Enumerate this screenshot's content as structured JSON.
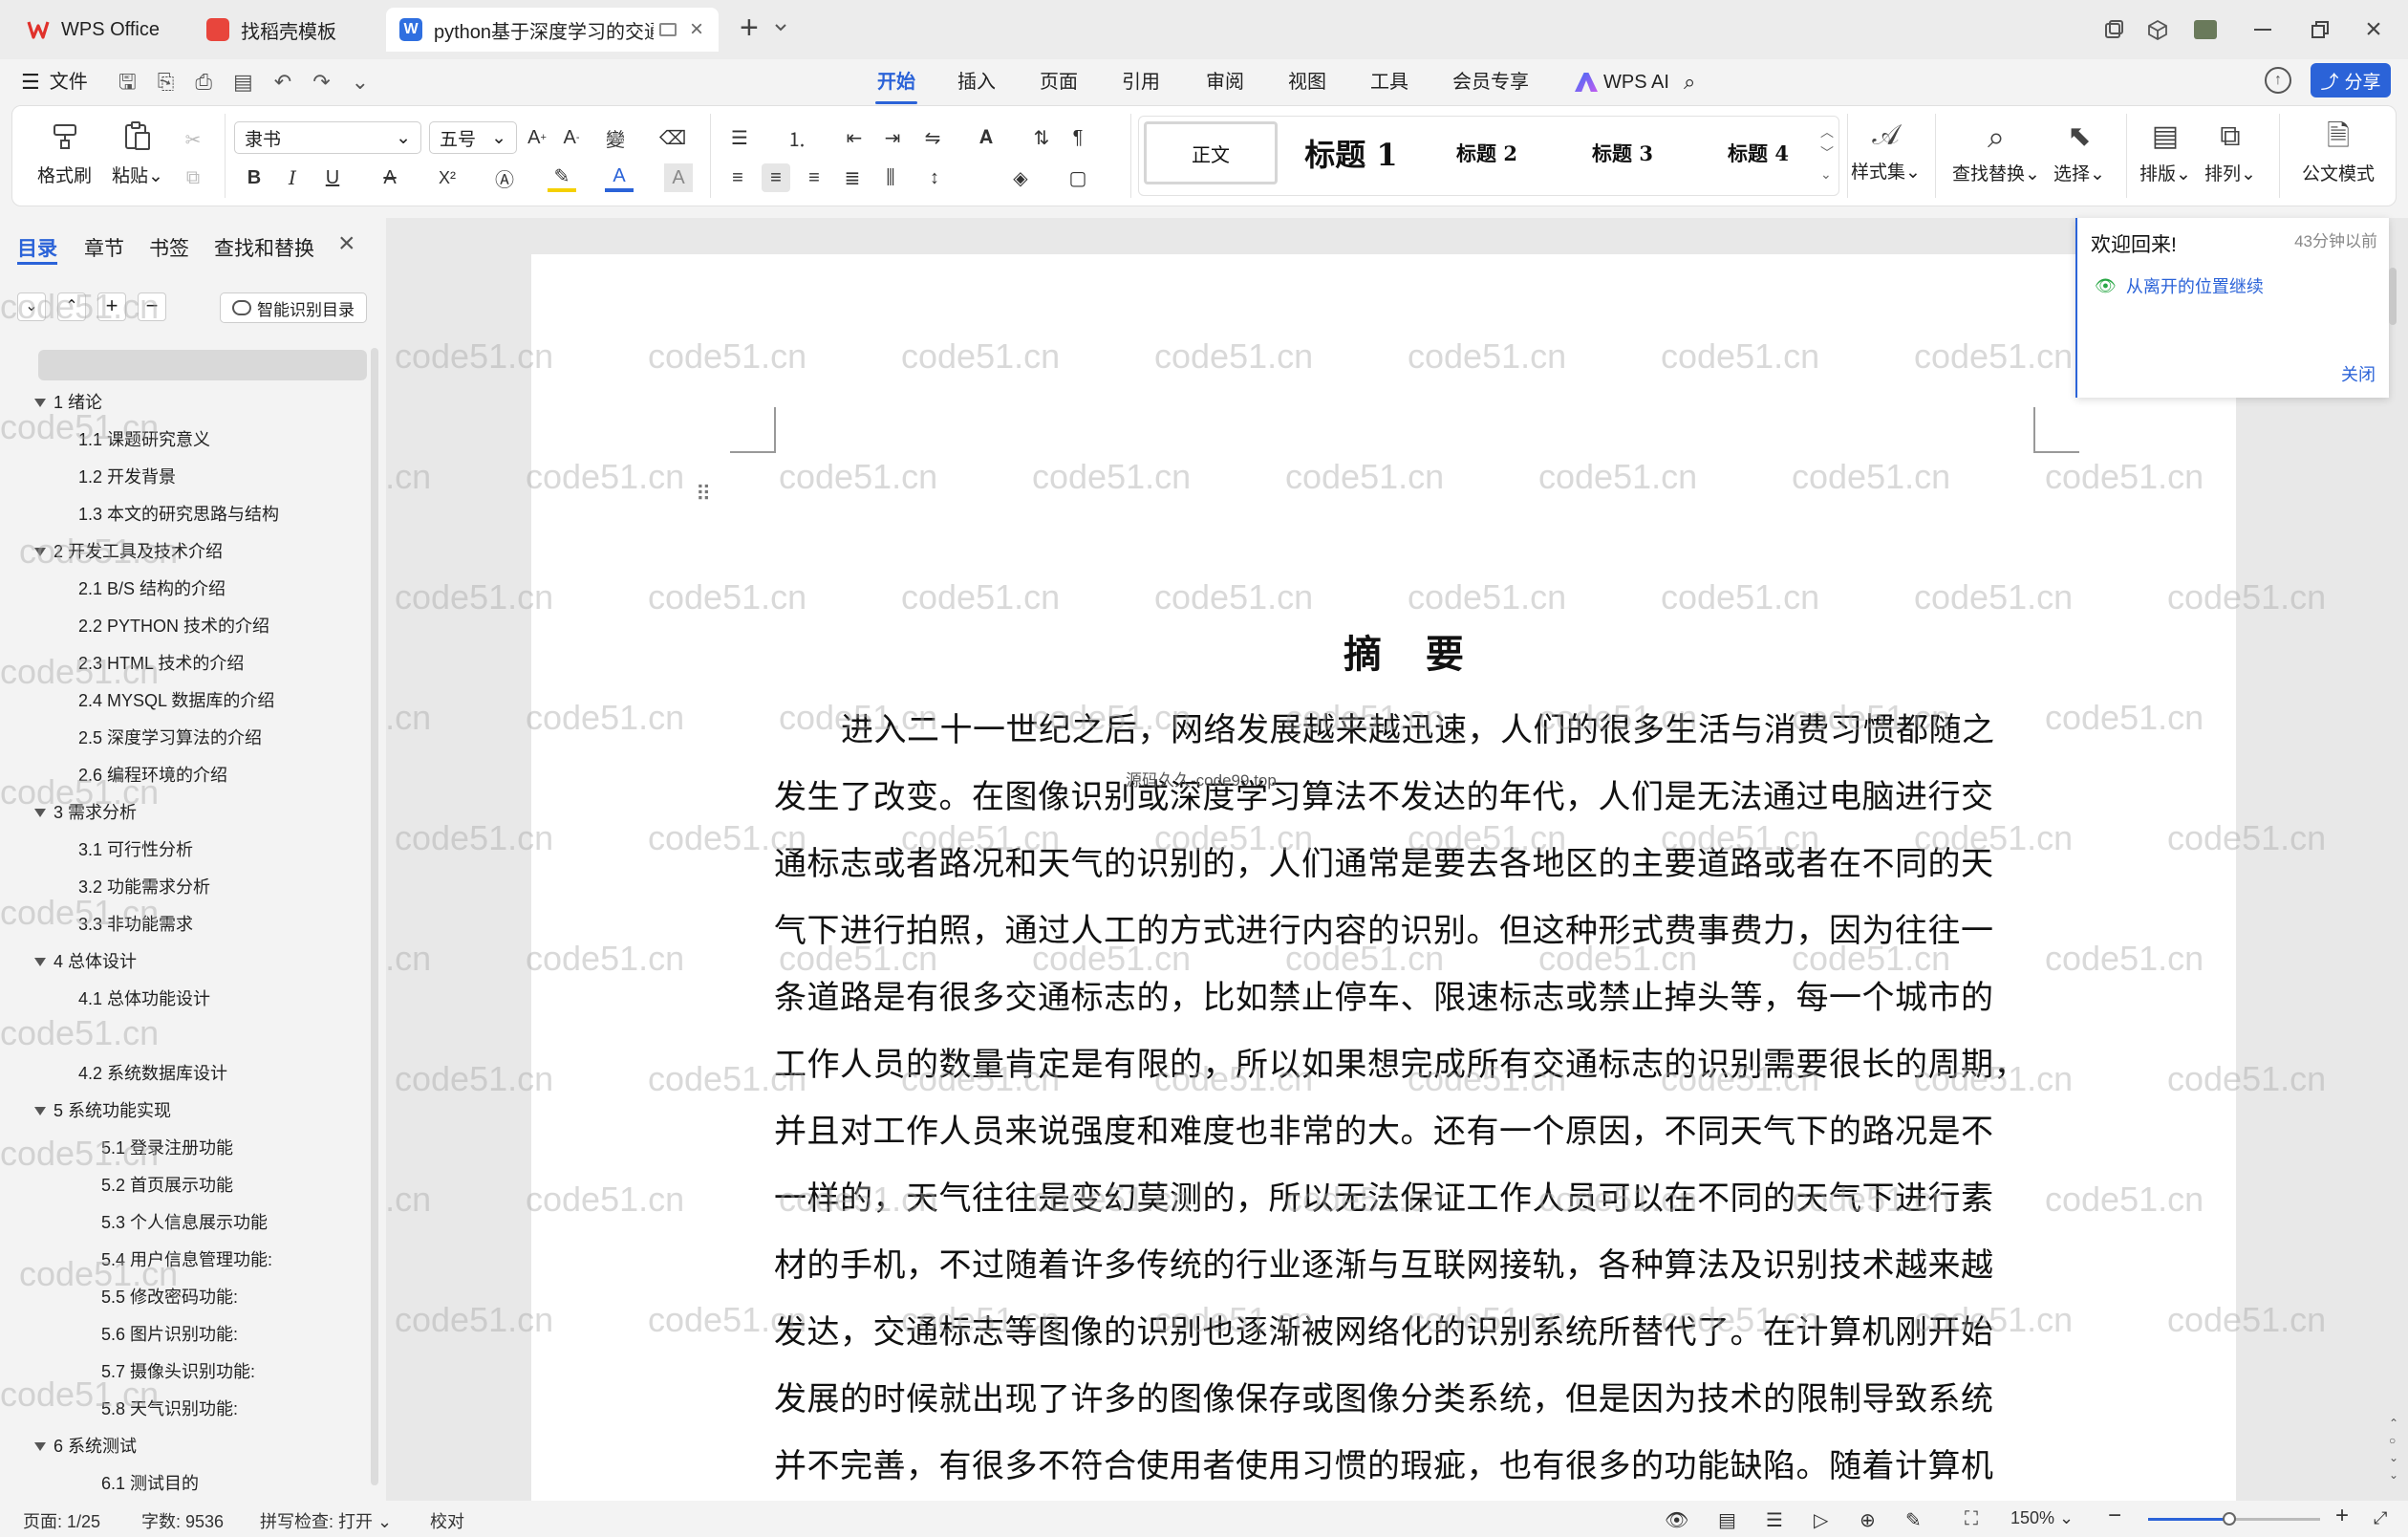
{
  "tabs": [
    {
      "label": "WPS Office",
      "icon": "wps-logo-icon"
    },
    {
      "label": "找稻壳模板",
      "icon": "daoke-logo-icon"
    },
    {
      "label": "python基于深度学习的交通",
      "icon": "word-doc-icon"
    }
  ],
  "menu": {
    "file": "文件",
    "tabs": [
      "开始",
      "插入",
      "页面",
      "引用",
      "审阅",
      "视图",
      "工具",
      "会员专享"
    ],
    "active": "开始",
    "ai": "WPS AI",
    "share": "分享"
  },
  "ribbon": {
    "format_painter": "格式刷",
    "paste": "粘贴",
    "font_name": "隶书",
    "font_size": "五号",
    "styles": [
      "正文",
      "标题 1",
      "标题 2",
      "标题 3",
      "标题 4"
    ],
    "style_set": "样式集",
    "find_replace": "查找替换",
    "select": "选择",
    "layout": "排版",
    "arrange": "排列",
    "official_mode": "公文模式",
    "bold": "B",
    "italic": "I",
    "underline": "U",
    "strike": "A",
    "superscript": "X²"
  },
  "sidebar": {
    "tabs": [
      "目录",
      "章节",
      "书签",
      "查找和替换"
    ],
    "active_tab": "目录",
    "smart_toc": "智能识别目录",
    "toc": [
      {
        "label": "1 绪论",
        "level": 1
      },
      {
        "label": "1.1 课题研究意义",
        "level": 2
      },
      {
        "label": "1.2 开发背景",
        "level": 2
      },
      {
        "label": "1.3 本文的研究思路与结构",
        "level": 2
      },
      {
        "label": "2 开发工具及技术介绍",
        "level": 1
      },
      {
        "label": "2.1 B/S 结构的介绍",
        "level": 2
      },
      {
        "label": "2.2 PYTHON 技术的介绍",
        "level": 2
      },
      {
        "label": "2.3 HTML 技术的介绍",
        "level": 2
      },
      {
        "label": "2.4 MYSQL 数据库的介绍",
        "level": 2
      },
      {
        "label": "2.5  深度学习算法的介绍",
        "level": 2
      },
      {
        "label": "2.6  编程环境的介绍",
        "level": 2
      },
      {
        "label": "3  需求分析",
        "level": 1
      },
      {
        "label": "3.1  可行性分析",
        "level": 2
      },
      {
        "label": "3.2  功能需求分析",
        "level": 2
      },
      {
        "label": "3.3  非功能需求",
        "level": 2
      },
      {
        "label": "4  总体设计",
        "level": 1
      },
      {
        "label": "4.1  总体功能设计",
        "level": 2
      },
      {
        "label": "",
        "level": 2
      },
      {
        "label": "4.2  系统数据库设计",
        "level": 2
      },
      {
        "label": "5  系统功能实现",
        "level": 1
      },
      {
        "label": "5.1  登录注册功能",
        "level": 3
      },
      {
        "label": "5.2  首页展示功能",
        "level": 3
      },
      {
        "label": "5.3  个人信息展示功能",
        "level": 3
      },
      {
        "label": "5.4  用户信息管理功能:",
        "level": 3
      },
      {
        "label": "5.5  修改密码功能:",
        "level": 3
      },
      {
        "label": "5.6 图片识别功能:",
        "level": 3
      },
      {
        "label": "5.7 摄像头识别功能:",
        "level": 3
      },
      {
        "label": "5.8 天气识别功能:",
        "level": 3
      },
      {
        "label": "6  系统测试",
        "level": 1
      },
      {
        "label": "6.1  测试目的",
        "level": 3
      }
    ]
  },
  "document": {
    "heading": "摘  要",
    "lines": [
      "进入二十一世纪之后，网络发展越来越迅速，人们的很多生活与消费习惯都随之",
      "发生了改变。在图像识别或深度学习算法不发达的年代，人们是无法通过电脑进行交",
      "通标志或者路况和天气的识别的，人们通常是要去各地区的主要道路或者在不同的天",
      "气下进行拍照，通过人工的方式进行内容的识别。但这种形式费事费力，因为往往一",
      "条道路是有很多交通标志的，比如禁止停车、限速标志或禁止掉头等，每一个城市的",
      "工作人员的数量肯定是有限的，所以如果想完成所有交通标志的识别需要很长的周期，",
      "并且对工作人员来说强度和难度也非常的大。还有一个原因，不同天气下的路况是不",
      "一样的，天气往往是变幻莫测的，所以无法保证工作人员可以在不同的天气下进行素",
      "材的手机，不过随着许多传统的行业逐渐与互联网接轨，各种算法及识别技术越来越",
      "发达，交通标志等图像的识别也逐渐被网络化的识别系统所替代了。在计算机刚开始",
      "发展的时候就出现了许多的图像保存或图像分类系统，但是因为技术的限制导致系统",
      "并不完善，有很多不符合使用者使用习惯的瑕疵，也有很多的功能缺陷。随着计算机"
    ],
    "inline_watermark": "源码久久-code99.top"
  },
  "popup": {
    "title": "欢迎回来!",
    "time": "43分钟以前",
    "resume": "从离开的位置继续",
    "close": "关闭"
  },
  "status": {
    "page": "页面: 1/25",
    "words": "字数: 9536",
    "spell": "拼写检查: 打开",
    "proof": "校对",
    "zoom": "150%"
  },
  "watermark": "code51.cn"
}
